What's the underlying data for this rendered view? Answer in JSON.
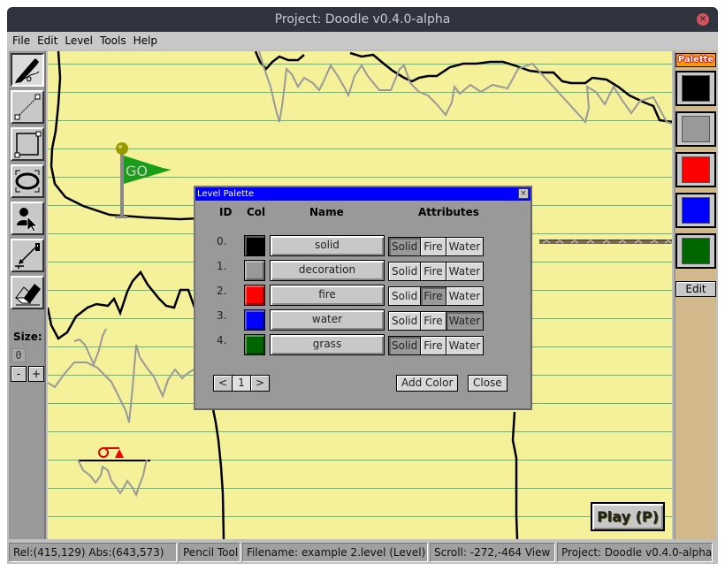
{
  "window": {
    "title": "Project: Doodle v0.4.0-alpha",
    "close_icon": "×"
  },
  "menu": {
    "items": [
      "File",
      "Edit",
      "Level",
      "Tools",
      "Help"
    ]
  },
  "toolbox": {
    "tools": [
      {
        "name": "pencil-tool",
        "icon": "pencil-icon",
        "active": true
      },
      {
        "name": "line-tool",
        "icon": "line-icon",
        "active": false
      },
      {
        "name": "rectangle-tool",
        "icon": "rectangle-icon",
        "active": false
      },
      {
        "name": "ellipse-tool",
        "icon": "ellipse-icon",
        "active": false
      },
      {
        "name": "actor-tool",
        "icon": "actor-select-icon",
        "active": false
      },
      {
        "name": "link-tool",
        "icon": "link-icon",
        "active": false
      },
      {
        "name": "eraser-tool",
        "icon": "eraser-icon",
        "active": false
      }
    ],
    "size_label": "Size:",
    "size_value": "0",
    "size_minus": "-",
    "size_plus": "+"
  },
  "palette_panel": {
    "header": "Palette",
    "swatches": [
      {
        "name": "solid",
        "color": "#000000"
      },
      {
        "name": "decoration",
        "color": "#999999"
      },
      {
        "name": "fire",
        "color": "#ff0000"
      },
      {
        "name": "water",
        "color": "#0000ff"
      },
      {
        "name": "grass",
        "color": "#006600"
      }
    ],
    "edit_label": "Edit"
  },
  "canvas": {
    "start_flag_text": "GO",
    "play_button": "Play (P)"
  },
  "level_palette_dialog": {
    "title": "Level Palette",
    "close_icon": "×",
    "headers": {
      "id": "ID",
      "col": "Col",
      "name": "Name",
      "attributes": "Attributes"
    },
    "attribute_labels": [
      "Solid",
      "Fire",
      "Water"
    ],
    "rows": [
      {
        "id": "0.",
        "color": "#000000",
        "name": "solid",
        "solid": true,
        "fire": false,
        "water": false
      },
      {
        "id": "1.",
        "color": "#999999",
        "name": "decoration",
        "solid": false,
        "fire": false,
        "water": false
      },
      {
        "id": "2.",
        "color": "#ff0000",
        "name": "fire",
        "solid": false,
        "fire": true,
        "water": false
      },
      {
        "id": "3.",
        "color": "#0000ff",
        "name": "water",
        "solid": false,
        "fire": false,
        "water": true
      },
      {
        "id": "4.",
        "color": "#006600",
        "name": "grass",
        "solid": true,
        "fire": false,
        "water": false
      }
    ],
    "pager": {
      "prev": "<",
      "page": "1",
      "next": ">"
    },
    "add_color": "Add Color",
    "close": "Close"
  },
  "statusbar": {
    "coords": "Rel:(415,129)  Abs:(643,573)",
    "tool": "Pencil Tool",
    "filename": "Filename: example 2.level (Level)",
    "scroll": "Scroll: -272,-464   View",
    "project": "Project: Doodle v0.4.0-alpha"
  }
}
